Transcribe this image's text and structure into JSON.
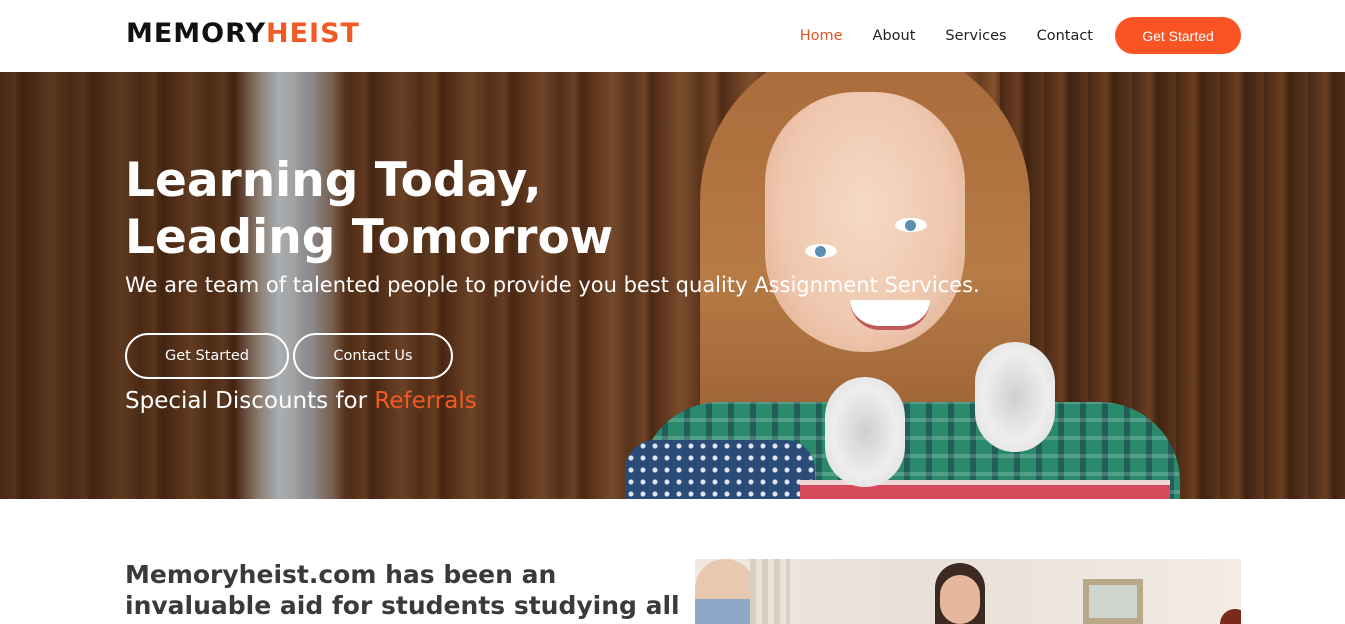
{
  "header": {
    "logo_part1": "MEMORY",
    "logo_part2": "HEIST",
    "nav": [
      "Home",
      "About",
      "Services",
      "Contact"
    ],
    "active_nav": "Home",
    "cta_label": "Get Started"
  },
  "hero": {
    "title": "Learning Today,\nLeading Tomorrow",
    "subtitle": "We are team of talented people to provide you best quality Assignment Services.",
    "button_primary": "Get Started",
    "button_secondary": "Contact Us",
    "discount_text": "Special Discounts for ",
    "discount_highlight": "Referrals"
  },
  "about": {
    "heading": "Memoryheist.com has been an invaluable aid for students studying all over the world"
  },
  "colors": {
    "accent": "#f15a24",
    "cta_bg": "#fb5424",
    "text_dark": "#222222"
  }
}
